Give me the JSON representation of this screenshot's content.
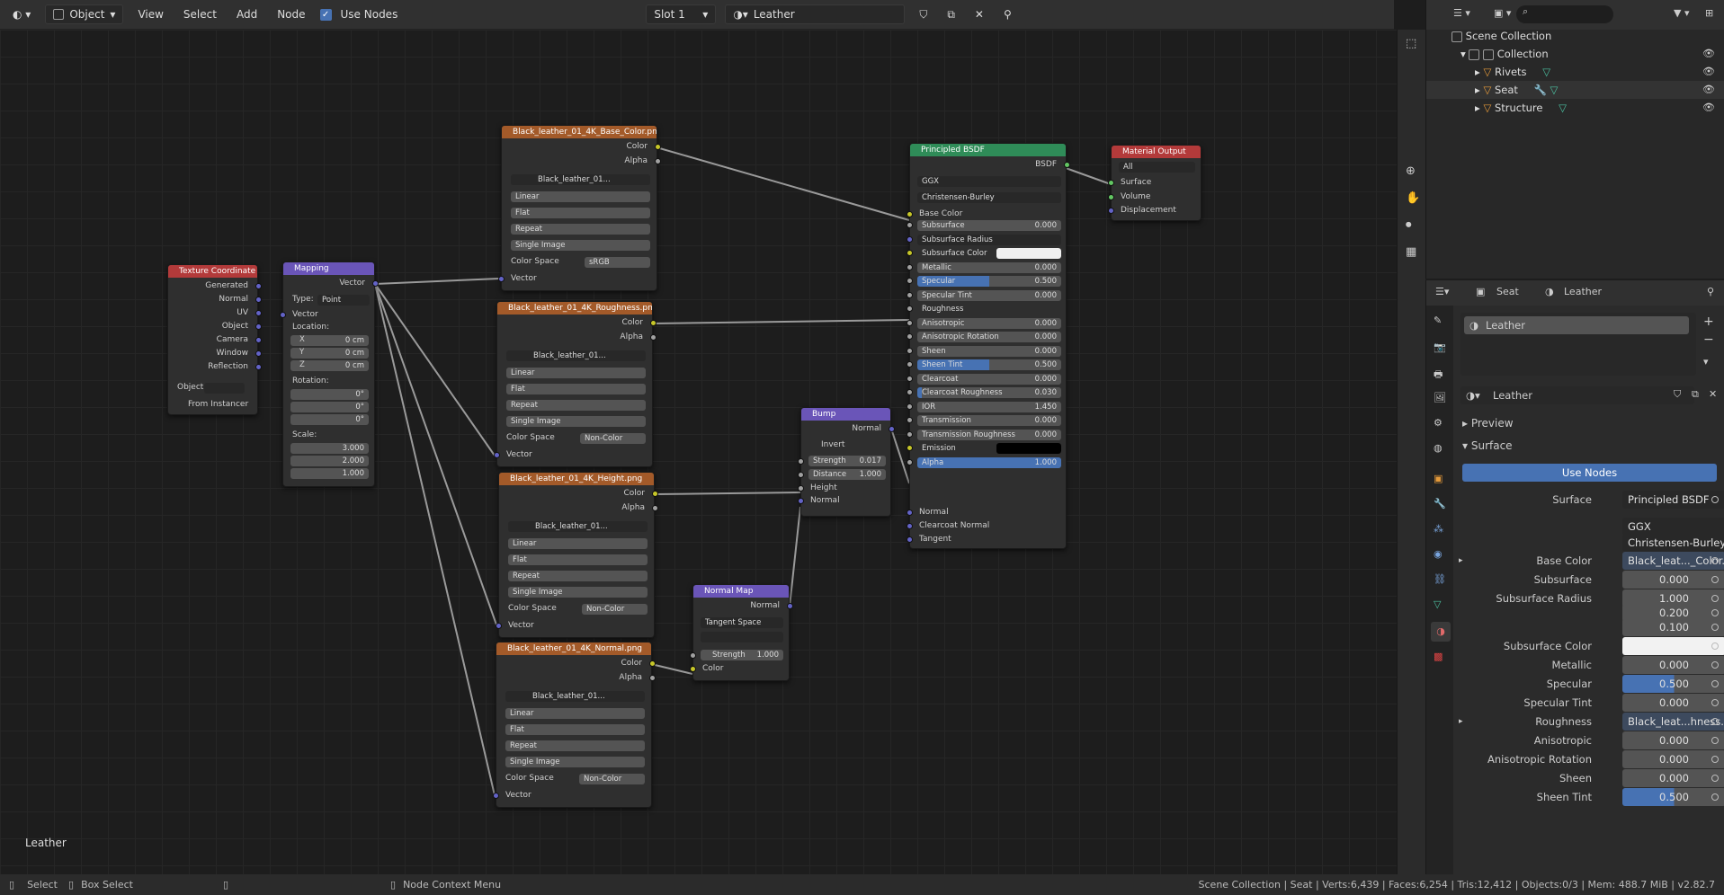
{
  "topbar": {
    "mode": "Object",
    "menus": [
      "View",
      "Select",
      "Add",
      "Node"
    ],
    "use_nodes": "Use Nodes",
    "slot": "Slot 1",
    "material": "Leather"
  },
  "canvas_label": "Leather",
  "nodes": {
    "texcoord": {
      "title": "Texture Coordinate",
      "outputs": [
        "Generated",
        "Normal",
        "UV",
        "Object",
        "Camera",
        "Window",
        "Reflection"
      ],
      "object_label": "Object",
      "from_instancer": "From Instancer"
    },
    "mapping": {
      "title": "Mapping",
      "out": "Vector",
      "type_label": "Type:",
      "type_val": "Point",
      "vector": "Vector",
      "location": "Location:",
      "loc": [
        "0 cm",
        "0 cm",
        "0 cm"
      ],
      "rotation": "Rotation:",
      "rot": [
        "0°",
        "0°",
        "0°"
      ],
      "scale": "Scale:",
      "scl": [
        "3.000",
        "2.000",
        "1.000"
      ],
      "axes": [
        "X",
        "Y",
        "Z"
      ]
    },
    "tex_base": {
      "title": "Black_leather_01_4K_Base_Color.png",
      "img": "Black_leather_01...",
      "interp": "Linear",
      "proj": "Flat",
      "ext": "Repeat",
      "src": "Single Image",
      "cs_label": "Color Space",
      "cs": "sRGB"
    },
    "tex_rough": {
      "title": "Black_leather_01_4K_Roughness.png",
      "img": "Black_leather_01...",
      "interp": "Linear",
      "proj": "Flat",
      "ext": "Repeat",
      "src": "Single Image",
      "cs_label": "Color Space",
      "cs": "Non-Color"
    },
    "tex_height": {
      "title": "Black_leather_01_4K_Height.png",
      "img": "Black_leather_01...",
      "interp": "Linear",
      "proj": "Flat",
      "ext": "Repeat",
      "src": "Single Image",
      "cs_label": "Color Space",
      "cs": "Non-Color"
    },
    "tex_normal": {
      "title": "Black_leather_01_4K_Normal.png",
      "img": "Black_leather_01...",
      "interp": "Linear",
      "proj": "Flat",
      "ext": "Repeat",
      "src": "Single Image",
      "cs_label": "Color Space",
      "cs": "Non-Color"
    },
    "sock": {
      "color": "Color",
      "alpha": "Alpha",
      "vector": "Vector"
    },
    "bump": {
      "title": "Bump",
      "out": "Normal",
      "invert": "Invert",
      "strength_l": "Strength",
      "strength": "0.017",
      "distance_l": "Distance",
      "distance": "1.000",
      "height": "Height",
      "normal": "Normal"
    },
    "normalmap": {
      "title": "Normal Map",
      "out": "Normal",
      "space": "Tangent Space",
      "strength_l": "Strength",
      "strength": "1.000",
      "color": "Color"
    },
    "bsdf": {
      "title": "Principled BSDF",
      "out": "BSDF",
      "dist": "GGX",
      "sss": "Christensen-Burley",
      "base_color": "Base Color",
      "fields": [
        {
          "l": "Subsurface",
          "v": "0.000",
          "f": 0
        },
        {
          "l": "Subsurface Radius",
          "v": "",
          "f": 0
        },
        {
          "l": "Subsurface Color",
          "v": "",
          "f": 0
        },
        {
          "l": "Metallic",
          "v": "0.000",
          "f": 0
        },
        {
          "l": "Specular",
          "v": "0.500",
          "f": 0.5
        },
        {
          "l": "Specular Tint",
          "v": "0.000",
          "f": 0
        },
        {
          "l": "Roughness",
          "v": "",
          "f": 0
        },
        {
          "l": "Anisotropic",
          "v": "0.000",
          "f": 0
        },
        {
          "l": "Anisotropic Rotation",
          "v": "0.000",
          "f": 0
        },
        {
          "l": "Sheen",
          "v": "0.000",
          "f": 0
        },
        {
          "l": "Sheen Tint",
          "v": "0.500",
          "f": 0.5
        },
        {
          "l": "Clearcoat",
          "v": "0.000",
          "f": 0
        },
        {
          "l": "Clearcoat Roughness",
          "v": "0.030",
          "f": 0.03
        },
        {
          "l": "IOR",
          "v": "1.450",
          "f": 0
        },
        {
          "l": "Transmission",
          "v": "0.000",
          "f": 0
        },
        {
          "l": "Transmission Roughness",
          "v": "0.000",
          "f": 0
        },
        {
          "l": "Emission",
          "v": "",
          "f": 0
        },
        {
          "l": "Alpha",
          "v": "1.000",
          "f": 1
        }
      ],
      "bottom": [
        "Normal",
        "Clearcoat Normal",
        "Tangent"
      ]
    },
    "output": {
      "title": "Material Output",
      "target": "All",
      "inputs": [
        "Surface",
        "Volume",
        "Displacement"
      ]
    }
  },
  "outliner": {
    "root": "Scene Collection",
    "collection": "Collection",
    "items": [
      "Rivets",
      "Seat",
      "Structure"
    ]
  },
  "props": {
    "object": "Seat",
    "material": "Leather",
    "slot": "Leather",
    "mat_field": "Leather",
    "preview": "Preview",
    "surface_hdr": "Surface",
    "use_nodes": "Use Nodes",
    "rows": [
      {
        "l": "Surface",
        "v": "Principled BSDF",
        "t": "dark"
      },
      {
        "l": "",
        "v": "GGX",
        "t": "dark"
      },
      {
        "l": "",
        "v": "Christensen-Burley",
        "t": "dark"
      },
      {
        "l": "Base Color",
        "v": "Black_leat..._Color.png",
        "t": "link"
      },
      {
        "l": "Subsurface",
        "v": "0.000",
        "t": "num"
      },
      {
        "l": "Subsurface Radius",
        "v": "1.000",
        "t": "num"
      },
      {
        "l": "",
        "v": "0.200",
        "t": "num"
      },
      {
        "l": "",
        "v": "0.100",
        "t": "num"
      },
      {
        "l": "Subsurface Color",
        "v": "",
        "t": "white"
      },
      {
        "l": "Metallic",
        "v": "0.000",
        "t": "num"
      },
      {
        "l": "Specular",
        "v": "0.500",
        "t": "bar"
      },
      {
        "l": "Specular Tint",
        "v": "0.000",
        "t": "num"
      },
      {
        "l": "Roughness",
        "v": "Black_leat...hness.png",
        "t": "link"
      },
      {
        "l": "Anisotropic",
        "v": "0.000",
        "t": "num"
      },
      {
        "l": "Anisotropic Rotation",
        "v": "0.000",
        "t": "num"
      },
      {
        "l": "Sheen",
        "v": "0.000",
        "t": "num"
      },
      {
        "l": "Sheen Tint",
        "v": "0.500",
        "t": "bar"
      }
    ]
  },
  "status": {
    "select": "Select",
    "box_select": "Box Select",
    "context": "Node Context Menu",
    "info": "Scene Collection | Seat | Verts:6,439 | Faces:6,254 | Tris:12,412 | Objects:0/3 | Mem: 488.7 MiB | v2.82.7"
  },
  "colors": {
    "texture_header": "#a35a29",
    "input_header": "#b33a3a",
    "vector_header": "#6a55b8",
    "shader_header": "#2f8c58",
    "accent": "#4772b3"
  }
}
